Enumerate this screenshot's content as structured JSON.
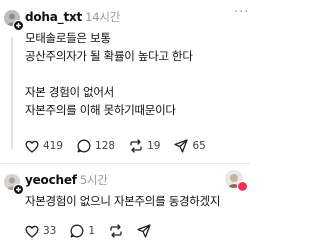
{
  "posts": [
    {
      "username": "doha_txt",
      "time": "14시간",
      "lines": [
        "모태솔로들은 보통",
        "공산주의자가 될 확률이 높다고 한다",
        "",
        "자본 경험이 없어서",
        "자본주의를 이해 못하기때문이다"
      ],
      "likes": "419",
      "comments": "128",
      "reposts": "19",
      "shares": "65"
    },
    {
      "username": "yeochef",
      "time": "5시간",
      "lines": [
        "자본경험이 없으니 자본주의를 동경하겠지"
      ],
      "likes": "33",
      "comments": "1",
      "reposts": "",
      "shares": ""
    }
  ],
  "icons": {
    "like": "heart-icon",
    "comment": "comment-icon",
    "repost": "repost-icon",
    "share": "share-icon",
    "more": "more-icon",
    "follow": "plus-icon"
  },
  "colors": {
    "text": "#111111",
    "muted": "#9a9a9a",
    "divider": "#e6e6e6"
  }
}
